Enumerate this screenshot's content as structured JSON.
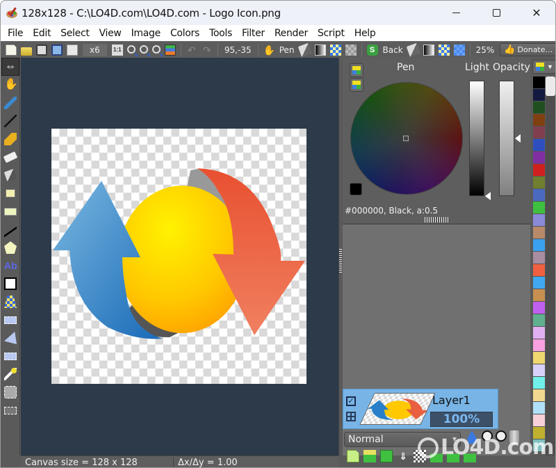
{
  "window": {
    "title": "128x128 - C:\\LO4D.com\\LO4D.com - Logo Icon.png",
    "controls": {
      "minimize": "",
      "maximize": "",
      "close": "✕"
    }
  },
  "menu": [
    "File",
    "Edit",
    "Select",
    "View",
    "Image",
    "Colors",
    "Tools",
    "Filter",
    "Render",
    "Script",
    "Help"
  ],
  "toolbar": {
    "zoom_factor": "x6",
    "actual_size_label": "1:1",
    "cursor_position": "95,-35",
    "pen_label": "Pen",
    "back_label": "Back",
    "zoom_percent": "25%",
    "donate_label": "Donate...",
    "icons": [
      "new-file-icon",
      "open-folder-icon",
      "save-icon",
      "save-as-icon",
      "copy-icon",
      "actual-size-icon",
      "zoom-in-icon",
      "zoom-out-icon",
      "zoom-fit-icon",
      "layers-icon",
      "undo-icon",
      "redo-icon",
      "hand-icon",
      "pen-fill-icon",
      "pen-gradient-icon",
      "pen-texture-icon",
      "pen-transparent-icon",
      "swap-colors-icon",
      "back-fill-icon",
      "back-gradient-icon",
      "back-texture-icon",
      "back-transparent-icon",
      "thumbs-up-icon"
    ]
  },
  "tools": [
    {
      "name": "move-tool",
      "glyph": "⇔",
      "active": true
    },
    {
      "name": "hand-tool",
      "glyph": "✋"
    },
    {
      "name": "color-picker-tool"
    },
    {
      "name": "pen-tool"
    },
    {
      "name": "brush-tool"
    },
    {
      "name": "eraser-tool"
    },
    {
      "name": "fill-tool"
    },
    {
      "name": "select-pointer-tool"
    },
    {
      "name": "rectangle-tool"
    },
    {
      "name": "polyline-tool"
    },
    {
      "name": "polygon-tool"
    },
    {
      "name": "text-tool",
      "glyph": "Ab"
    },
    {
      "name": "perspective-tool"
    },
    {
      "name": "texture-mapping-tool"
    },
    {
      "name": "select-rectangle-tool"
    },
    {
      "name": "select-polygon-tool"
    },
    {
      "name": "select-pen-tool"
    },
    {
      "name": "magic-wand-tool"
    },
    {
      "name": "move-selection-tool"
    },
    {
      "name": "crop-selection-tool"
    }
  ],
  "color_panel": {
    "title": "Pen",
    "light_label": "Light",
    "opacity_label": "Opacity",
    "readout": "#000000, Black, a:0.5",
    "current_color": "#000000",
    "lightness": 0.0,
    "opacity": 0.5
  },
  "palette": {
    "swatches": [
      "#000000",
      "#14193f",
      "#1f4f20",
      "#7f3f10",
      "#7f3f4f",
      "#2f4fbf",
      "#7f2fa0",
      "#cf1f1f",
      "#6f7f2f",
      "#4a6ac0",
      "#3fbf3f",
      "#8a8ad8",
      "#b88a6a",
      "#3aa0f0",
      "#a88ca0",
      "#f06040",
      "#40a8f0",
      "#c89050",
      "#c060f0",
      "#60b090",
      "#e0b0f0",
      "#f8a0e0",
      "#f0d870",
      "#d8d0f8",
      "#70f0e8",
      "#f0d890",
      "#b0e0f8",
      "#f8d0d8",
      "#c0b030",
      "#80c0c0"
    ]
  },
  "layers": {
    "items": [
      {
        "name": "Layer1",
        "opacity": "100%",
        "visible": true
      }
    ],
    "blend_mode": "Normal"
  },
  "status": {
    "canvas_size": "Canvas size = 128 x 128",
    "aspect": "Δx/Δy = 1.00"
  },
  "watermark": "LO4D.com"
}
